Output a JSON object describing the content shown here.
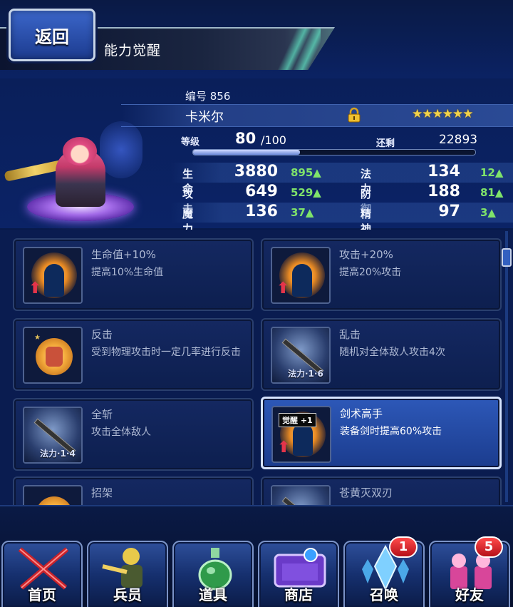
{
  "header": {
    "back_label": "返回",
    "title": "能力觉醒"
  },
  "unit": {
    "number_label": "编号 856",
    "name": "卡米尔",
    "stars": "★★★★★★",
    "level_label": "等级",
    "level": "80",
    "level_max": "/100",
    "remain_label": "还剩",
    "remain_value": "22893",
    "exp_fraction": 0.38
  },
  "stats": [
    {
      "label": "生命",
      "value": "3880",
      "bonus": "895▲"
    },
    {
      "label": "法力",
      "value": "134",
      "bonus": "12▲"
    },
    {
      "label": "攻击",
      "value": "649",
      "bonus": "529▲"
    },
    {
      "label": "防御",
      "value": "188",
      "bonus": "81▲"
    },
    {
      "label": "魔力",
      "value": "136",
      "bonus": "37▲"
    },
    {
      "label": "精神",
      "value": "97",
      "bonus": "3▲"
    }
  ],
  "abilities": [
    {
      "title": "生命值+10%",
      "desc": "提高10%生命值",
      "icon": "buff-body-icon"
    },
    {
      "title": "攻击+20%",
      "desc": "提高20%攻击",
      "icon": "buff-body-icon"
    },
    {
      "title": "反击",
      "desc": "受到物理攻击时一定几率进行反击",
      "icon": "fist-icon"
    },
    {
      "title": "乱击",
      "desc": "随机对全体敌人攻击4次",
      "icon": "sword-icon",
      "mp": "法力·1·6"
    },
    {
      "title": "全斩",
      "desc": "攻击全体敌人",
      "icon": "sword-icon",
      "mp": "法力·1·4"
    },
    {
      "title": "剑术高手",
      "desc": "装备剑时提高60%攻击",
      "icon": "buff-body-icon",
      "badge": "觉醒 +1"
    },
    {
      "title": "招架",
      "desc": "",
      "icon": "fist-icon"
    },
    {
      "title": "苍黄灭双刃",
      "desc": "",
      "icon": "sword-icon"
    }
  ],
  "nav": {
    "tabs": [
      {
        "label": "首页",
        "icon": "home-swords-icon"
      },
      {
        "label": "兵员",
        "icon": "units-icon"
      },
      {
        "label": "道具",
        "icon": "items-potion-icon"
      },
      {
        "label": "商店",
        "icon": "shop-icon"
      },
      {
        "label": "召唤",
        "icon": "summon-crystal-icon",
        "badge": "1"
      },
      {
        "label": "好友",
        "icon": "friends-icon",
        "badge": "5"
      }
    ]
  },
  "colors": {
    "bonus_green": "#7fe36a",
    "star_gold": "#f3d34a",
    "badge_red": "#e0202a",
    "highlight_card": "#2d58b8"
  }
}
